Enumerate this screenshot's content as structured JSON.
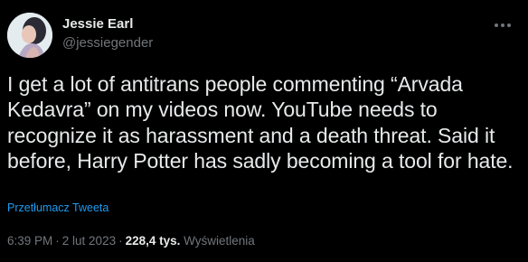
{
  "author": {
    "name": "Jessie Earl",
    "handle": "@jessiegender"
  },
  "tweet": {
    "text": "I get a lot of antitrans people commenting “Arvada Kedavra” on my videos now. YouTube needs to recognize it as harassment and a death threat. Said it before, Harry Potter has sadly becoming a tool for hate.",
    "translate_label": "Przetłumacz Tweeta"
  },
  "meta": {
    "time": "6:39 PM",
    "separator": "·",
    "date": "2 lut 2023",
    "views_count": "228,4 tys.",
    "views_label": "Wyświetlenia"
  },
  "icons": {
    "more": "more-horizontal-icon"
  },
  "colors": {
    "background": "#000000",
    "primary_text": "#e7e9ea",
    "secondary_text": "#71767b",
    "link": "#1d9bf0"
  }
}
